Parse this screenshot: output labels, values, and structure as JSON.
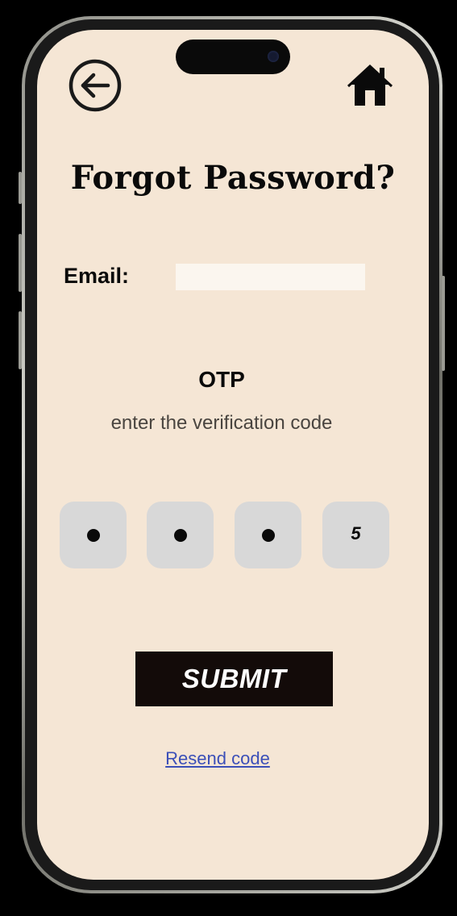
{
  "header": {
    "back_icon": "arrow-left-circle-icon",
    "home_icon": "home-icon"
  },
  "title": "Forgot Password?",
  "email": {
    "label": "Email:",
    "value": "",
    "placeholder": ""
  },
  "otp": {
    "heading": "OTP",
    "subtitle": "enter the verification code",
    "digits": [
      {
        "masked": true,
        "value": ""
      },
      {
        "masked": true,
        "value": ""
      },
      {
        "masked": true,
        "value": ""
      },
      {
        "masked": false,
        "value": "5"
      }
    ]
  },
  "submit_label": "SUBMIT",
  "resend_label": "Resend code",
  "colors": {
    "background": "#f5e6d5",
    "submit_bg": "#130b09",
    "link": "#3b4fb8",
    "otp_box": "#d8d8d8",
    "email_field": "#fbf6ef"
  }
}
